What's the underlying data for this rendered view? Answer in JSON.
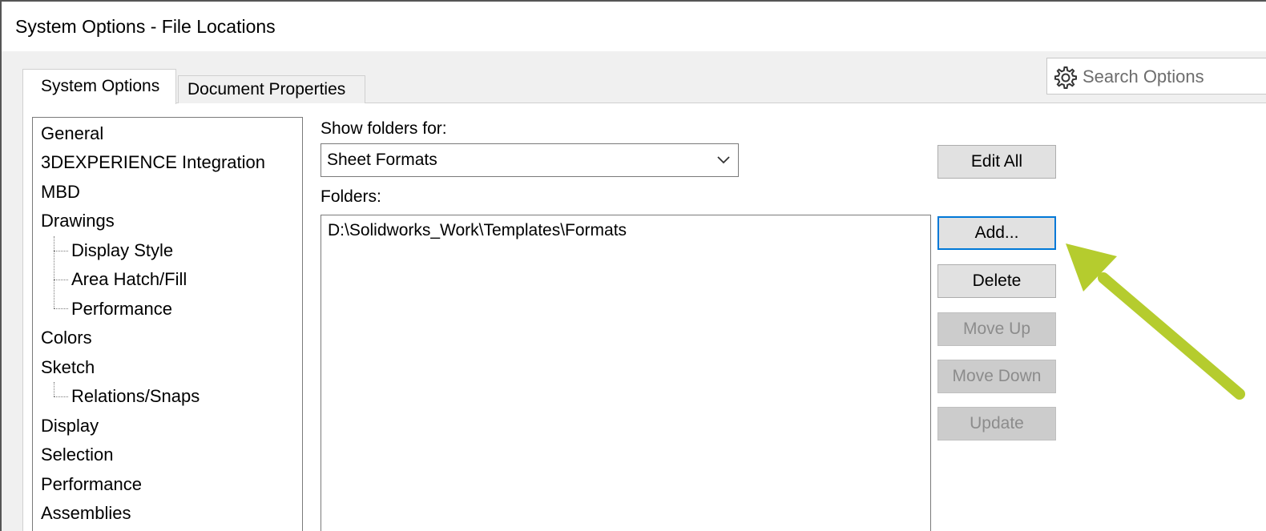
{
  "window": {
    "title": "System Options - File Locations"
  },
  "search": {
    "placeholder": "Search Options",
    "icon": "gear-icon"
  },
  "tabs": [
    {
      "label": "System Options",
      "active": true
    },
    {
      "label": "Document Properties",
      "active": false
    }
  ],
  "tree": {
    "items": [
      {
        "label": "General",
        "level": 1
      },
      {
        "label": "3DEXPERIENCE Integration",
        "level": 1
      },
      {
        "label": "MBD",
        "level": 1
      },
      {
        "label": "Drawings",
        "level": 1
      },
      {
        "label": "Display Style",
        "level": 2
      },
      {
        "label": "Area Hatch/Fill",
        "level": 2
      },
      {
        "label": "Performance",
        "level": 2
      },
      {
        "label": "Colors",
        "level": 1
      },
      {
        "label": "Sketch",
        "level": 1
      },
      {
        "label": "Relations/Snaps",
        "level": 2
      },
      {
        "label": "Display",
        "level": 1
      },
      {
        "label": "Selection",
        "level": 1
      },
      {
        "label": "Performance",
        "level": 1
      },
      {
        "label": "Assemblies",
        "level": 1
      }
    ]
  },
  "main": {
    "show_folders_label": "Show folders for:",
    "show_folders_value": "Sheet Formats",
    "folders_label": "Folders:",
    "folders": [
      "D:\\Solidworks_Work\\Templates\\Formats"
    ]
  },
  "buttons": {
    "edit_all": {
      "label": "Edit All",
      "enabled": true
    },
    "add": {
      "label": "Add...",
      "enabled": true,
      "focused": true
    },
    "delete": {
      "label": "Delete",
      "enabled": true
    },
    "move_up": {
      "label": "Move Up",
      "enabled": false
    },
    "move_down": {
      "label": "Move Down",
      "enabled": false
    },
    "update": {
      "label": "Update",
      "enabled": false
    }
  },
  "annotation": {
    "arrow_color": "#b5cc2e",
    "points_to": "add-button"
  },
  "colors": {
    "focus_border": "#0078d7",
    "disabled_text": "#8c8c8c"
  }
}
